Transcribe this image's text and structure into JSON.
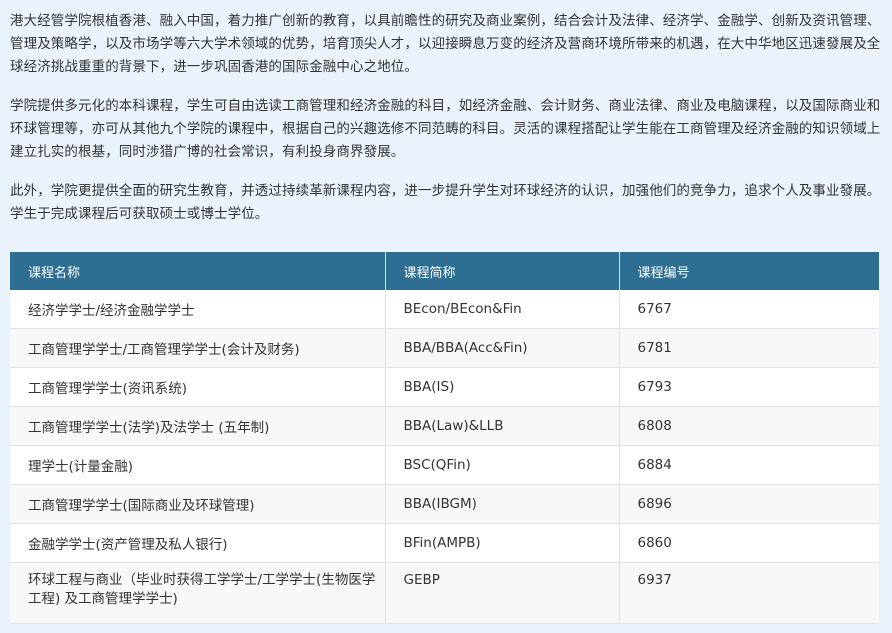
{
  "paragraphs": [
    "港大经管学院根植香港、融入中国，着力推广创新的教育，以具前瞻性的研究及商业案例，结合会计及法律、经济学、金融学、创新及资讯管理、管理及策略学，以及市场学等六大学术领域的优势，培育顶尖人才，以迎接瞬息万变的经济及营商环境所带来的机遇，在大中华地区迅速發展及全球经济挑战重重的背景下，进一步巩固香港的国际金融中心之地位。",
    "学院提供多元化的本科课程，学生可自由选读工商管理和经济金融的科目，如经济金融、会计财务、商业法律、商业及电脑课程，以及国际商业和环球管理等，亦可从其他九个学院的课程中，根据自己的兴趣选修不同范畴的科目。灵活的课程搭配让学生能在工商管理及经济金融的知识领域上建立扎实的根基，同时涉猎广博的社会常识，有利投身商界發展。",
    "此外，学院更提供全面的研究生教育，并透过持续革新课程内容，进一步提升学生对环球经济的认识，加强他们的竞争力，追求个人及事业發展。学生于完成课程后可获取硕士或博士学位。"
  ],
  "table": {
    "headers": [
      "课程名称",
      "课程简称",
      "课程编号"
    ],
    "rows": [
      {
        "name": "经济学学士/经济金融学学士",
        "abbr": "BEcon/BEcon&Fin",
        "code": "6767"
      },
      {
        "name": "工商管理学学士/工商管理学学士(会计及财务)",
        "abbr": "BBA/BBA(Acc&Fin)",
        "code": "6781"
      },
      {
        "name": "工商管理学学士(资讯系统)",
        "abbr": "BBA(IS)",
        "code": "6793"
      },
      {
        "name": "工商管理学学士(法学)及法学士 (五年制)",
        "abbr": "BBA(Law)&LLB",
        "code": "6808"
      },
      {
        "name": "理学士(计量金融)",
        "abbr": "BSC(QFin)",
        "code": "6884"
      },
      {
        "name": "工商管理学学士(国际商业及环球管理)",
        "abbr": "BBA(IBGM)",
        "code": "6896"
      },
      {
        "name": "金融学学士(资产管理及私人银行)",
        "abbr": "BFin(AMPB)",
        "code": "6860"
      },
      {
        "name": "环球工程与商业（毕业时获得工学学士/工学学士(生物医学工程) 及工商管理学学士)",
        "abbr": "GEBP",
        "code": "6937"
      }
    ]
  },
  "colors": {
    "page_background": "#eaf2fc",
    "header_background": "#2e6e92",
    "header_text": "#ffffff",
    "body_text": "#333333"
  }
}
